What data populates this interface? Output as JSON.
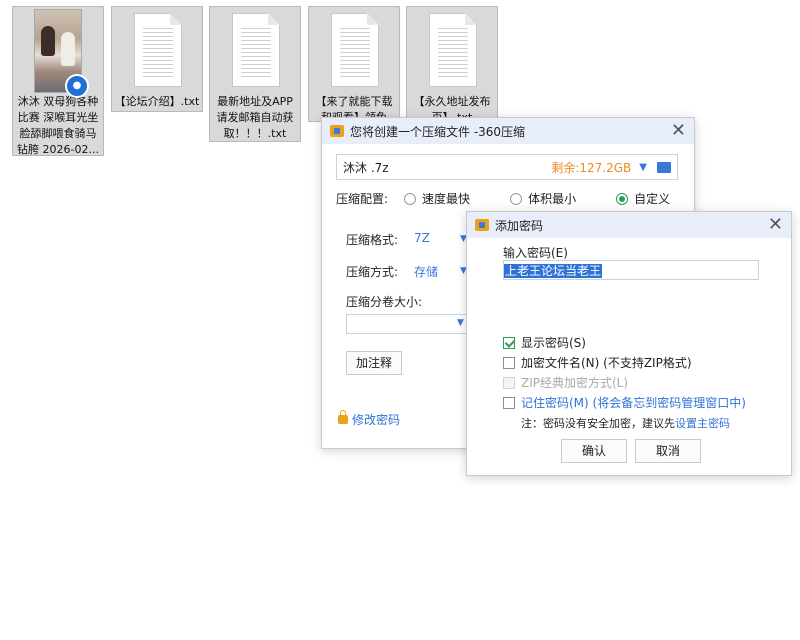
{
  "desktop": {
    "files": [
      {
        "name": "沐沐 双母狗各种比赛 深喉耳光坐脸舔脚喂食骑马钻胯 2026-02...",
        "icon": "video-thumbnail-icon"
      },
      {
        "name": "【论坛介绍】.txt",
        "icon": "text-file-icon"
      },
      {
        "name": "最新地址及APP请发邮箱自动获取！！！.txt",
        "icon": "text-file-icon"
      },
      {
        "name": "【来了就能下载和观看】领免",
        "icon": "text-file-icon"
      },
      {
        "name": "【永久地址发布页】.txt",
        "icon": "text-file-icon"
      }
    ]
  },
  "compress_dialog": {
    "title": "您将创建一个压缩文件 -360压缩",
    "file_name": "沐沐 .7z",
    "free_space": "剩余:127.2GB",
    "config_label": "压缩配置:",
    "options": [
      "速度最快",
      "体积最小",
      "自定义"
    ],
    "selected_option": "自定义",
    "format_label": "压缩格式:",
    "format_value": "7Z",
    "method_label": "压缩方式:",
    "method_value": "存储",
    "volume_label": "压缩分卷大小:",
    "note_button": "加注释",
    "modify_password": "修改密码"
  },
  "password_dialog": {
    "title": "添加密码",
    "input_label": "输入密码(E)",
    "password_value": "上老王论坛当老王",
    "show_password": "显示密码(S)",
    "encrypt_names": "加密文件名(N) (不支持ZIP格式)",
    "zip_classic": "ZIP经典加密方式(L)",
    "remember": "记住密码(M) (将会备忘到密码管理窗口中)",
    "note_prefix": "注：密码没有安全加密，建议先",
    "note_link": "设置主密码",
    "ok": "确认",
    "cancel": "取消"
  },
  "colors": {
    "accent": "#2f73d6",
    "orange": "#f08a24",
    "green": "#2e9b52",
    "titlebar": "#e7eefa"
  }
}
